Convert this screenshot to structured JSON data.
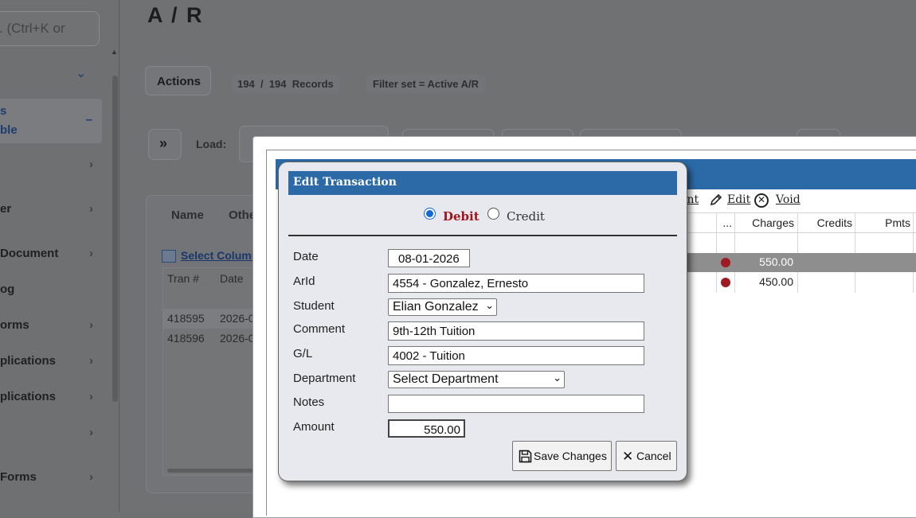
{
  "sidebar": {
    "search_placeholder": ". (Ctrl+K or",
    "items": [
      {
        "label": "er"
      },
      {
        "label": "Document"
      },
      {
        "label": "og"
      },
      {
        "label": "orms"
      },
      {
        "label": "plications"
      },
      {
        "label": "plications"
      },
      {
        "label": "Forms"
      }
    ],
    "active_item": {
      "line1": "s",
      "line2": "ble",
      "toggle": "–"
    }
  },
  "page": {
    "title": "A / R",
    "actions_label": "Actions",
    "records": {
      "shown": "194",
      "sep": "/",
      "total": "194",
      "suffix": "Records"
    },
    "filter": "Filter set =  Active A/R",
    "expand_symbol": "»",
    "load_label": "Load:",
    "tabs": [
      "Name",
      "Othe"
    ],
    "select_columns": "Select Column",
    "grid_headers": [
      "Tran #",
      "Date"
    ],
    "grid_rows": [
      {
        "tran": "418595",
        "date": "2026-0"
      },
      {
        "tran": "418596",
        "date": "2026-0"
      }
    ]
  },
  "popup": {
    "toolbar": {
      "print": "int",
      "edit": "Edit",
      "void": "Void"
    },
    "columns": [
      "...",
      "Charges",
      "Credits",
      "Pmts"
    ],
    "rows": [
      {
        "charges": "550.00",
        "selected": true
      },
      {
        "charges": "450.00",
        "selected": false
      }
    ]
  },
  "dialog": {
    "title": "Edit Transaction",
    "debit_label": "Debit",
    "credit_label": "Credit",
    "selected_type": "Debit",
    "fields": {
      "date": {
        "label": "Date",
        "value": "08-01-2026"
      },
      "arid": {
        "label": "ArId",
        "value": "4554 - Gonzalez, Ernesto"
      },
      "student": {
        "label": "Student",
        "value": "Elian Gonzalez"
      },
      "comment": {
        "label": "Comment",
        "value": "9th-12th Tuition"
      },
      "gl": {
        "label": "G/L",
        "value": "4002 - Tuition"
      },
      "department": {
        "label": "Department",
        "value": "Select Department"
      },
      "notes": {
        "label": "Notes",
        "value": ""
      },
      "amount": {
        "label": "Amount",
        "value": "550.00"
      }
    },
    "save_label": "Save Changes",
    "cancel_label": "Cancel"
  },
  "colors": {
    "accent_blue": "#2b6aa6",
    "debit_red": "#a0141c",
    "status_dot": "#9e1b24"
  }
}
